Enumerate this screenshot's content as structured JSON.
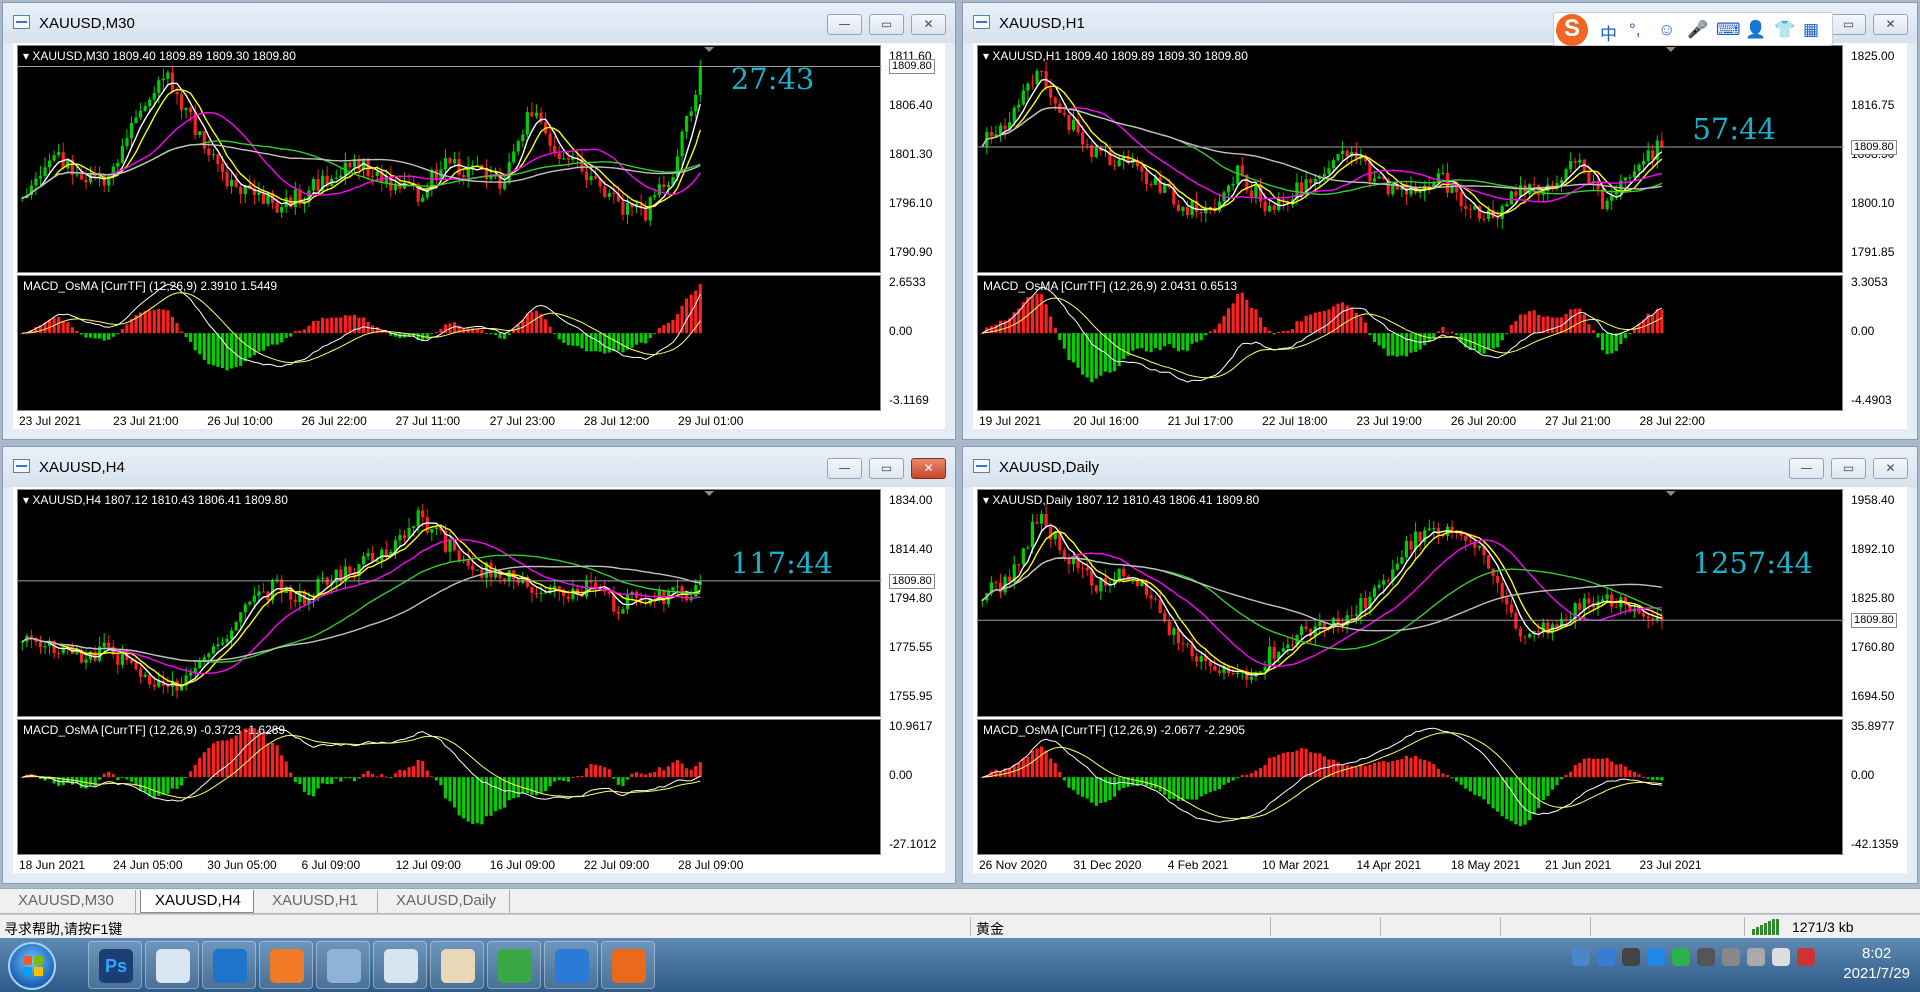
{
  "windows": [
    {
      "id": "m30",
      "title": "XAUUSD,M30",
      "info": "XAUUSD,M30  1809.40 1809.89 1809.30 1809.80",
      "timer": "27:43",
      "bid": "1809.80",
      "price_labels": [
        "1811.60",
        "1806.40",
        "1801.30",
        "1796.10",
        "1790.90"
      ],
      "macd_label": "MACD_OsMA [CurrTF] (12,26,9) 2.3910 1.5449",
      "macd_labels": [
        "2.6533",
        "0.00",
        "-3.1169"
      ],
      "time_labels": [
        "23 Jul 2021",
        "23 Jul 21:00",
        "26 Jul 10:00",
        "26 Jul 22:00",
        "27 Jul 11:00",
        "27 Jul 23:00",
        "28 Jul 12:00",
        "29 Jul 01:00"
      ],
      "close_active": false
    },
    {
      "id": "h1",
      "title": "XAUUSD,H1",
      "info": "XAUUSD,H1  1809.40 1809.89 1809.30 1809.80",
      "timer": "57:44",
      "bid": "1809.80",
      "price_labels": [
        "1825.00",
        "1816.75",
        "1808.50",
        "1800.10",
        "1791.85"
      ],
      "macd_label": "MACD_OsMA [CurrTF] (12,26,9) 2.0431 0.6513",
      "macd_labels": [
        "3.3053",
        "0.00",
        "-4.4903"
      ],
      "time_labels": [
        "19 Jul 2021",
        "20 Jul 16:00",
        "21 Jul 17:00",
        "22 Jul 18:00",
        "23 Jul 19:00",
        "26 Jul 20:00",
        "27 Jul 21:00",
        "28 Jul 22:00"
      ],
      "close_active": false
    },
    {
      "id": "h4",
      "title": "XAUUSD,H4",
      "info": "XAUUSD,H4  1807.12 1810.43 1806.41 1809.80",
      "timer": "117:44",
      "bid": "1809.80",
      "price_labels": [
        "1834.00",
        "1814.40",
        "1794.80",
        "1775.55",
        "1755.95"
      ],
      "macd_label": "MACD_OsMA [CurrTF] (12,26,9) -0.3723 -1.6289",
      "macd_labels": [
        "10.9617",
        "0.00",
        "-27.1012"
      ],
      "time_labels": [
        "18 Jun 2021",
        "24 Jun 05:00",
        "30 Jun 05:00",
        "6 Jul 09:00",
        "12 Jul 09:00",
        "16 Jul 09:00",
        "22 Jul 09:00",
        "28 Jul 09:00"
      ],
      "close_active": true
    },
    {
      "id": "daily",
      "title": "XAUUSD,Daily",
      "info": "XAUUSD,Daily  1807.12 1810.43 1806.41 1809.80",
      "timer": "1257:44",
      "bid": "1809.80",
      "price_labels": [
        "1958.40",
        "1892.10",
        "1825.80",
        "1760.80",
        "1694.50"
      ],
      "macd_label": "MACD_OsMA [CurrTF] (12,26,9) -2.0677 -2.2905",
      "macd_labels": [
        "35.8977",
        "0.00",
        "-42.1359"
      ],
      "time_labels": [
        "26 Nov 2020",
        "31 Dec 2020",
        "4 Feb 2021",
        "10 Mar 2021",
        "14 Apr 2021",
        "18 May 2021",
        "21 Jun 2021",
        "23 Jul 2021"
      ],
      "close_active": false
    }
  ],
  "tabs": [
    "XAUUSD,M30",
    "XAUUSD,H4",
    "XAUUSD,H1",
    "XAUUSD,Daily"
  ],
  "active_tab": "XAUUSD,H4",
  "status": {
    "help": "寻求帮助,请按F1键",
    "symbol": "黄金",
    "traffic": "1271/3 kb"
  },
  "ime": {
    "items": [
      "中",
      "°,",
      "☺",
      "🎤",
      "⌨",
      "👤",
      "👕",
      "▦"
    ]
  },
  "taskbar": {
    "apps": [
      "Ps",
      "",
      "",
      "",
      "",
      "",
      "",
      "",
      "",
      ""
    ],
    "time": "8:02",
    "date": "2021/7/29"
  },
  "colors": {
    "bull": "#00d000",
    "bear": "#ff2020",
    "ma_fast": "#ffffff",
    "ma_yellow": "#ffff00",
    "ma_magenta": "#ff00ff",
    "ma_green": "#32cd32",
    "ma_silver": "#c0c0c0",
    "timer": "#1ab2c8"
  }
}
